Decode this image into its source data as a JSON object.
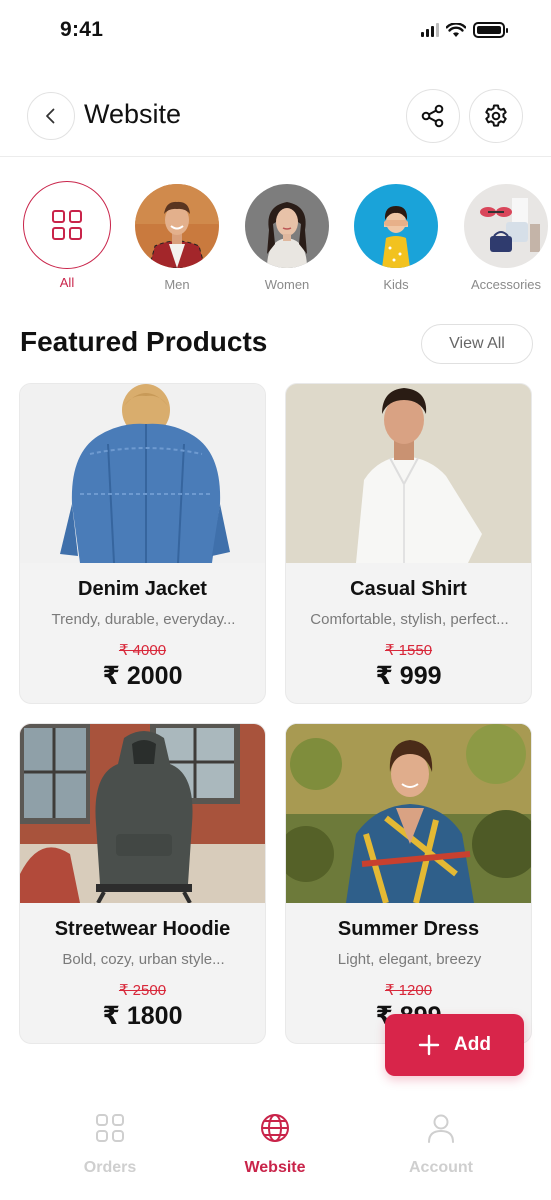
{
  "status_bar": {
    "time": "9:41"
  },
  "header": {
    "title": "Website"
  },
  "categories": [
    {
      "label": "All",
      "active": true
    },
    {
      "label": "Men",
      "active": false
    },
    {
      "label": "Women",
      "active": false
    },
    {
      "label": "Kids",
      "active": false
    },
    {
      "label": "Accessories",
      "active": false
    }
  ],
  "featured": {
    "title": "Featured Products",
    "view_all_label": "View All",
    "products": [
      {
        "name": "Denim Jacket",
        "description": "Trendy, durable, everyday...",
        "old_price": "₹ 4000",
        "price": "₹ 2000"
      },
      {
        "name": "Casual Shirt",
        "description": "Comfortable, stylish, perfect...",
        "old_price": "₹ 1550",
        "price": "₹ 999"
      },
      {
        "name": "Streetwear Hoodie",
        "description": "Bold, cozy, urban style...",
        "old_price": "₹ 2500",
        "price": "₹ 1800"
      },
      {
        "name": "Summer Dress",
        "description": "Light, elegant, breezy",
        "old_price": "₹ 1200",
        "price": "₹ 899"
      }
    ]
  },
  "fab": {
    "label": "Add"
  },
  "bottom_nav": [
    {
      "label": "Orders",
      "icon": "grid-icon",
      "active": false
    },
    {
      "label": "Website",
      "icon": "globe-icon",
      "active": true
    },
    {
      "label": "Account",
      "icon": "user-icon",
      "active": false
    }
  ],
  "colors": {
    "accent": "#d8254a",
    "inactive_nav": "#cfcfcf",
    "strike_price": "#d8283a"
  }
}
